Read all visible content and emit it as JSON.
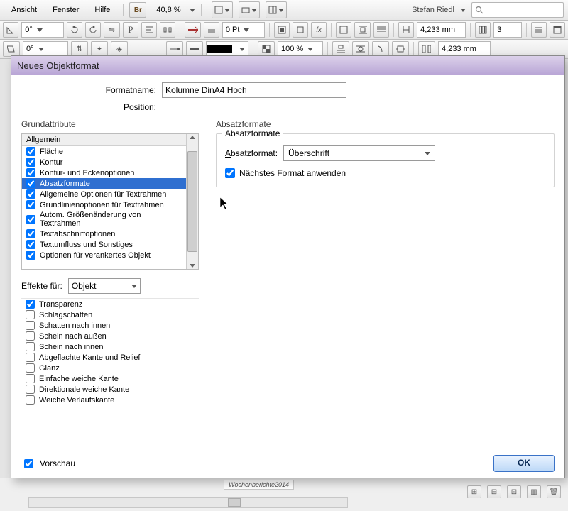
{
  "menu": {
    "view": "Ansicht",
    "window": "Fenster",
    "help": "Hilfe"
  },
  "zoom": "40,8 %",
  "user": "Stefan Riedl",
  "search_placeholder": "",
  "row2": {
    "angle1": "0°",
    "angle2": "0°",
    "pt": "0 Pt",
    "pct": "100 %",
    "width": "4,233 mm",
    "cols": "3",
    "gutter": "4,233 mm"
  },
  "dialog": {
    "title": "Neues Objektformat",
    "name_label": "Formatname:",
    "name_value": "Kolumne DinA4 Hoch",
    "position_label": "Position:",
    "left": {
      "section": "Grundattribute",
      "header": "Allgemein",
      "items": [
        {
          "label": "Fläche",
          "checked": true
        },
        {
          "label": "Kontur",
          "checked": true
        },
        {
          "label": "Kontur- und Eckenoptionen",
          "checked": true
        },
        {
          "label": "Absatzformate",
          "checked": true,
          "selected": true
        },
        {
          "label": "Allgemeine Optionen für Textrahmen",
          "checked": true
        },
        {
          "label": "Grundlinienoptionen für Textrahmen",
          "checked": true
        },
        {
          "label": "Autom. Größenänderung von Textrahmen",
          "checked": true
        },
        {
          "label": "Textabschnittoptionen",
          "checked": true
        },
        {
          "label": "Textumfluss und Sonstiges",
          "checked": true
        },
        {
          "label": "Optionen für verankertes Objekt",
          "checked": true
        }
      ],
      "effects_label": "Effekte für:",
      "effects_target": "Objekt",
      "fx": [
        {
          "label": "Transparenz",
          "checked": true
        },
        {
          "label": "Schlagschatten",
          "checked": false
        },
        {
          "label": "Schatten nach innen",
          "checked": false
        },
        {
          "label": "Schein nach außen",
          "checked": false
        },
        {
          "label": "Schein nach innen",
          "checked": false
        },
        {
          "label": "Abgeflachte Kante und Relief",
          "checked": false
        },
        {
          "label": "Glanz",
          "checked": false
        },
        {
          "label": "Einfache weiche Kante",
          "checked": false
        },
        {
          "label": "Direktionale weiche Kante",
          "checked": false
        },
        {
          "label": "Weiche Verlaufskante",
          "checked": false
        }
      ]
    },
    "right": {
      "section": "Absatzformate",
      "group": "Absatzformate",
      "para_label": "Absatzformat:",
      "para_value": "Überschrift",
      "apply_next": "Nächstes Format anwenden"
    },
    "preview": "Vorschau",
    "ok": "OK"
  },
  "status_tab": "Wochenberichte2014"
}
